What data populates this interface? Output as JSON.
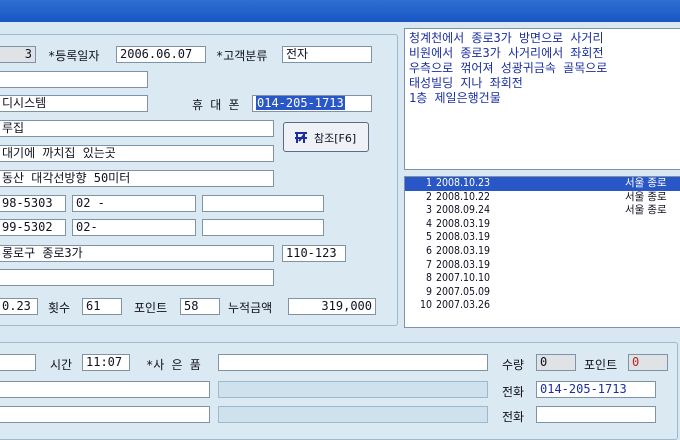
{
  "customer": {
    "no": "3",
    "reg_date_label": "*등록일자",
    "reg_date": "2006.06.07",
    "type_label": "*고객분류",
    "type": "전자",
    "company": "디시스템",
    "mobile_label": "휴 대 폰",
    "mobile": "014-205-1713",
    "store": "루집",
    "addr_note1": "대기에 까치집 있는곳",
    "addr_note2": "동산 대각선방향 50미터",
    "phone1": "98-5303",
    "phone1b": "02 -",
    "phone2": "99-5302",
    "phone2b": "02-",
    "address": "롱로구 종로3가",
    "zip": "110-123",
    "last_visit": "0.23",
    "count_label": "횟수",
    "count": "61",
    "point_label": "포인트",
    "point": "58",
    "total_label": "누적금액",
    "total": "319,000"
  },
  "ref_button": {
    "label": "참조[F6]",
    "icon": "lookup-icon"
  },
  "memo": {
    "lines": [
      "청계천에서 종로3가 방면으로 사거리",
      "비원에서 종로3가 사거리에서 좌회전",
      "우측으로 꺾어져 성광귀금속 골목으로",
      "태성빌딩 지나 좌회전",
      "1층 제일은행건물"
    ]
  },
  "history": [
    {
      "n": "1",
      "date": "2008.10.23",
      "branch": "서울 종로"
    },
    {
      "n": "2",
      "date": "2008.10.22",
      "branch": "서울 종로"
    },
    {
      "n": "3",
      "date": "2008.09.24",
      "branch": "서울 종로"
    },
    {
      "n": "4",
      "date": "2008.03.19",
      "branch": ""
    },
    {
      "n": "5",
      "date": "2008.03.19",
      "branch": ""
    },
    {
      "n": "6",
      "date": "2008.03.19",
      "branch": ""
    },
    {
      "n": "7",
      "date": "2008.03.19",
      "branch": ""
    },
    {
      "n": "8",
      "date": "2007.10.10",
      "branch": ""
    },
    {
      "n": "9",
      "date": "2007.05.09",
      "branch": ""
    },
    {
      "n": "10",
      "date": "2007.03.26",
      "branch": ""
    }
  ],
  "order": {
    "time_label": "시간",
    "time": "11:07",
    "gift_label": "*사 은 품",
    "qty_label": "수량",
    "qty": "0",
    "point_label": "포인트",
    "point": "0",
    "phone_label": "전화",
    "phone": "014-205-1713",
    "phone2_label": "전화"
  },
  "colors": {
    "titlebar": "#1856c4",
    "selection": "#2a57c8",
    "memo_text": "#1a2ea0",
    "background": "#d8e7f1"
  }
}
